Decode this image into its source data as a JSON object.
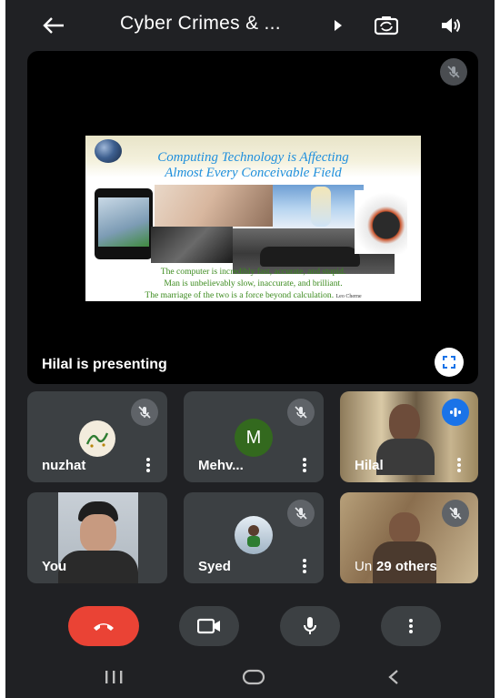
{
  "meeting": {
    "title": "Cyber Crimes & ..."
  },
  "presentation": {
    "label": "Hilal is presenting",
    "slide": {
      "title_line1": "Computing Technology is Affecting",
      "title_line2": "Almost  Every Conceivable Field",
      "quote_line1": "The computer is incredibly fast, accurate, and stupid.",
      "quote_line2": "Man is unbelievably slow, inaccurate, and brilliant.",
      "quote_line3": "The marriage of the two is a force beyond calculation.",
      "attribution": "Leo Cherne"
    }
  },
  "participants": [
    {
      "name": "nuzhat",
      "muted": true
    },
    {
      "name": "Mehv...",
      "initial": "M",
      "avatar_color": "#33691e",
      "muted": true
    },
    {
      "name": "Hilal",
      "speaking": true
    },
    {
      "name": "You"
    },
    {
      "name": "Syed",
      "muted": true
    },
    {
      "name": "Un",
      "others_label": "29 others",
      "muted": true
    }
  ],
  "colors": {
    "end_call": "#ea4335",
    "background": "#202124",
    "tile": "#3c4043",
    "speaking": "#1a73e8"
  },
  "icons": [
    "back-arrow-icon",
    "play-icon",
    "switch-camera-icon",
    "speaker-icon",
    "mic-off-icon",
    "fullscreen-icon",
    "more-vert-icon",
    "end-call-icon",
    "camera-icon",
    "mic-icon",
    "recents-icon",
    "home-icon",
    "back-icon"
  ]
}
